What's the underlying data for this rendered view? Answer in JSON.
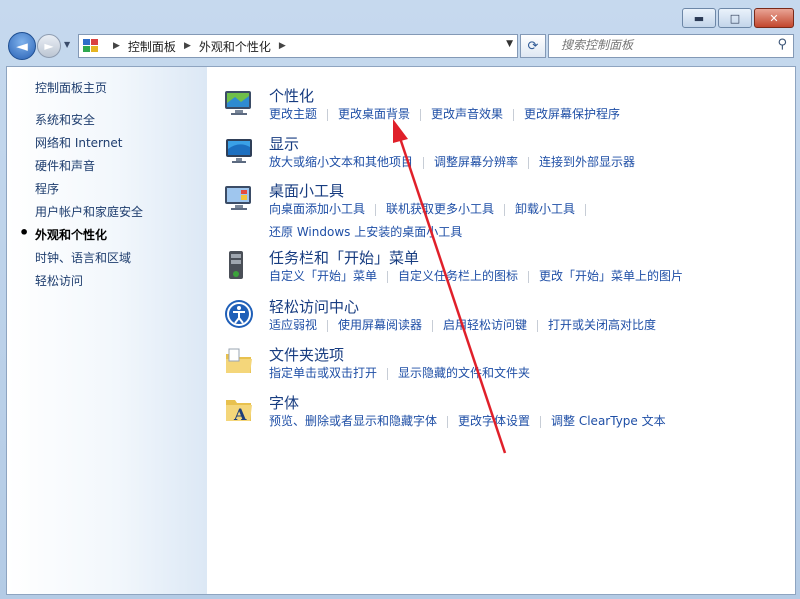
{
  "window": {
    "minimize": "▬",
    "maximize": "□",
    "close": "✕"
  },
  "nav": {
    "back": "◄",
    "forward": "►",
    "history": "▼",
    "breadcrumbs": [
      "控制面板",
      "外观和个性化"
    ],
    "refresh": "⟳",
    "search_placeholder": "搜索控制面板",
    "search_icon": "magnifier-icon"
  },
  "sidebar": {
    "home": "控制面板主页",
    "items": [
      {
        "label": "系统和安全",
        "active": false
      },
      {
        "label": "网络和 Internet",
        "active": false
      },
      {
        "label": "硬件和声音",
        "active": false
      },
      {
        "label": "程序",
        "active": false
      },
      {
        "label": "用户帐户和家庭安全",
        "active": false
      },
      {
        "label": "外观和个性化",
        "active": true
      },
      {
        "label": "时钟、语言和区域",
        "active": false
      },
      {
        "label": "轻松访问",
        "active": false
      }
    ]
  },
  "categories": [
    {
      "title": "个性化",
      "icon": "personalization-icon",
      "links": [
        "更改主题",
        "更改桌面背景",
        "更改声音效果",
        "更改屏幕保护程序"
      ]
    },
    {
      "title": "显示",
      "icon": "display-icon",
      "links": [
        "放大或缩小文本和其他项目",
        "调整屏幕分辨率",
        "连接到外部显示器"
      ]
    },
    {
      "title": "桌面小工具",
      "icon": "gadgets-icon",
      "links": [
        "向桌面添加小工具",
        "联机获取更多小工具",
        "卸载小工具"
      ],
      "links2": [
        "还原 Windows 上安装的桌面小工具"
      ]
    },
    {
      "title": "任务栏和「开始」菜单",
      "icon": "taskbar-icon",
      "links": [
        "自定义「开始」菜单",
        "自定义任务栏上的图标",
        "更改「开始」菜单上的图片"
      ]
    },
    {
      "title": "轻松访问中心",
      "icon": "ease-of-access-icon",
      "links": [
        "适应弱视",
        "使用屏幕阅读器",
        "启用轻松访问键",
        "打开或关闭高对比度"
      ]
    },
    {
      "title": "文件夹选项",
      "icon": "folder-options-icon",
      "links": [
        "指定单击或双击打开",
        "显示隐藏的文件和文件夹"
      ]
    },
    {
      "title": "字体",
      "icon": "fonts-icon",
      "links": [
        "预览、删除或者显示和隐藏字体",
        "更改字体设置",
        "调整 ClearType 文本"
      ]
    }
  ],
  "colors": {
    "link": "#1f4fa6",
    "title": "#173c80",
    "arrow": "#e0202a"
  }
}
